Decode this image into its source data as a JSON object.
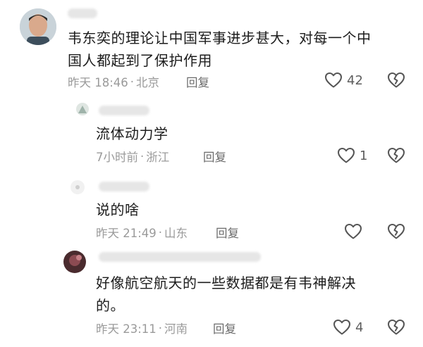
{
  "comments": [
    {
      "text_line1": "韦东奕的理论让中国军事进步甚大，对每一个中",
      "text_line2": "国人都起到了保护作用",
      "time": "昨天 18:46",
      "location": "北京",
      "reply_label": "回复",
      "likes": "42",
      "level": "top"
    },
    {
      "text_line1": "流体动力学",
      "time": "7小时前",
      "location": "浙江",
      "reply_label": "回复",
      "likes": "1",
      "level": "reply"
    },
    {
      "text_line1": "说的啥",
      "time": "昨天 21:49",
      "location": "山东",
      "reply_label": "回复",
      "likes": "",
      "level": "reply"
    },
    {
      "text_line1": "好像航空航天的一些数据都是有韦神解决",
      "text_line2": "的。",
      "time": "昨天 23:11",
      "location": "河南",
      "reply_label": "回复",
      "likes": "4",
      "level": "reply"
    }
  ],
  "colors": {
    "text": "#1c1c1c",
    "meta": "#9a9a9a",
    "icon": "#555555"
  },
  "icons": {
    "like": "heart-outline-icon",
    "dislike": "broken-heart-icon"
  }
}
